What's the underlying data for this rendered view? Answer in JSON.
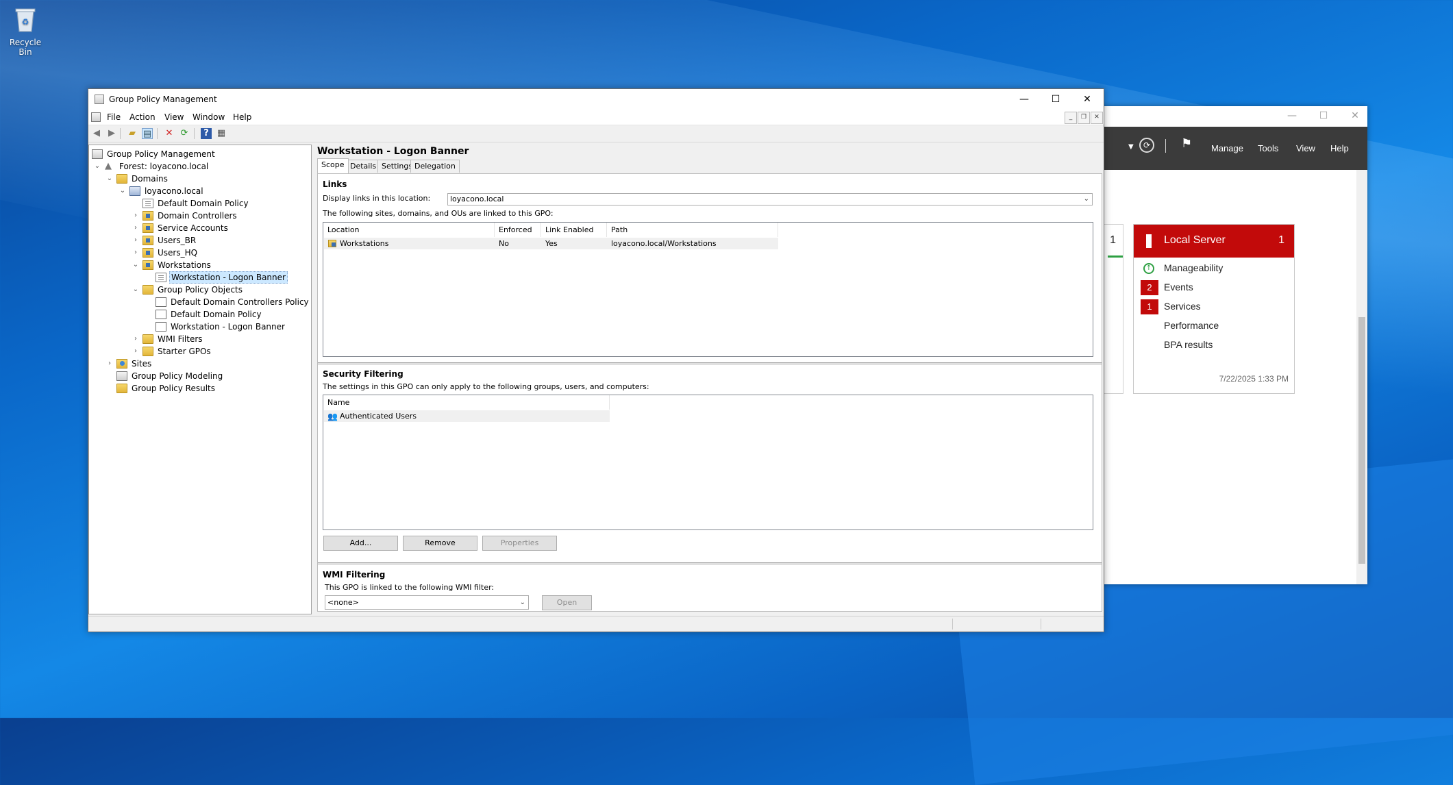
{
  "desktop": {
    "recycle_bin_label": "Recycle Bin"
  },
  "server_manager": {
    "menu": [
      "Manage",
      "Tools",
      "View",
      "Help"
    ],
    "prev_tile_count": "1",
    "tile": {
      "title": "Local Server",
      "count": "1",
      "rows": [
        {
          "label": "Manageability",
          "badge": ""
        },
        {
          "label": "Events",
          "badge": "2"
        },
        {
          "label": "Services",
          "badge": "1"
        },
        {
          "label": "Performance",
          "badge": ""
        },
        {
          "label": "BPA results",
          "badge": ""
        }
      ],
      "timestamp": "7/22/2025 1:33 PM"
    }
  },
  "gpmc": {
    "title": "Group Policy Management",
    "menu": [
      "File",
      "Action",
      "View",
      "Window",
      "Help"
    ],
    "tree": [
      {
        "label": "Group Policy Management",
        "icon": "gpm-icon",
        "depth": 0,
        "toggle": ""
      },
      {
        "label": "Forest: loyacono.local",
        "icon": "forest-icon",
        "depth": 0,
        "toggle": "v"
      },
      {
        "label": "Domains",
        "icon": "folder-icon",
        "depth": 1,
        "toggle": "v"
      },
      {
        "label": "loyacono.local",
        "icon": "domain-icon",
        "depth": 2,
        "toggle": "v"
      },
      {
        "label": "Default Domain Policy",
        "icon": "gpo-link-icon",
        "depth": 3,
        "toggle": ""
      },
      {
        "label": "Domain Controllers",
        "icon": "ou-icon",
        "depth": 3,
        "toggle": ">"
      },
      {
        "label": "Service Accounts",
        "icon": "ou-icon",
        "depth": 3,
        "toggle": ">"
      },
      {
        "label": "Users_BR",
        "icon": "ou-icon",
        "depth": 3,
        "toggle": ">"
      },
      {
        "label": "Users_HQ",
        "icon": "ou-icon",
        "depth": 3,
        "toggle": ">"
      },
      {
        "label": "Workstations",
        "icon": "ou-icon",
        "depth": 3,
        "toggle": "v"
      },
      {
        "label": "Workstation - Logon Banner",
        "icon": "gpo-link-icon",
        "depth": 4,
        "toggle": "",
        "selected": true
      },
      {
        "label": "Group Policy Objects",
        "icon": "folder-icon",
        "depth": 3,
        "toggle": "v"
      },
      {
        "label": "Default Domain Controllers Policy",
        "icon": "gpo-icon",
        "depth": 4,
        "toggle": ""
      },
      {
        "label": "Default Domain Policy",
        "icon": "gpo-icon",
        "depth": 4,
        "toggle": ""
      },
      {
        "label": "Workstation - Logon Banner",
        "icon": "gpo-icon",
        "depth": 4,
        "toggle": ""
      },
      {
        "label": "WMI Filters",
        "icon": "folder-icon",
        "depth": 3,
        "toggle": ">"
      },
      {
        "label": "Starter GPOs",
        "icon": "folder-icon",
        "depth": 3,
        "toggle": ">"
      },
      {
        "label": "Sites",
        "icon": "sites-icon",
        "depth": 1,
        "toggle": ">"
      },
      {
        "label": "Group Policy Modeling",
        "icon": "modeling-icon",
        "depth": 0,
        "toggle": ""
      },
      {
        "label": "Group Policy Results",
        "icon": "results-icon",
        "depth": 0,
        "toggle": ""
      }
    ],
    "detail": {
      "title": "Workstation - Logon Banner",
      "tabs": [
        "Scope",
        "Details",
        "Settings",
        "Delegation"
      ],
      "active_tab": "Scope",
      "links": {
        "heading": "Links",
        "display_label": "Display links in this location:",
        "location_value": "loyacono.local",
        "description": "The following sites, domains, and OUs are linked to this GPO:",
        "columns": [
          "Location",
          "Enforced",
          "Link Enabled",
          "Path"
        ],
        "rows": [
          {
            "location": "Workstations",
            "enforced": "No",
            "link_enabled": "Yes",
            "path": "loyacono.local/Workstations"
          }
        ]
      },
      "security": {
        "heading": "Security Filtering",
        "description": "The settings in this GPO can only apply to the following groups, users, and computers:",
        "columns": [
          "Name"
        ],
        "rows": [
          "Authenticated Users"
        ],
        "add_label": "Add...",
        "remove_label": "Remove",
        "properties_label": "Properties"
      },
      "wmi": {
        "heading": "WMI Filtering",
        "description": "This GPO is linked to the following WMI filter:",
        "filter_value": "<none>",
        "open_label": "Open"
      }
    }
  }
}
